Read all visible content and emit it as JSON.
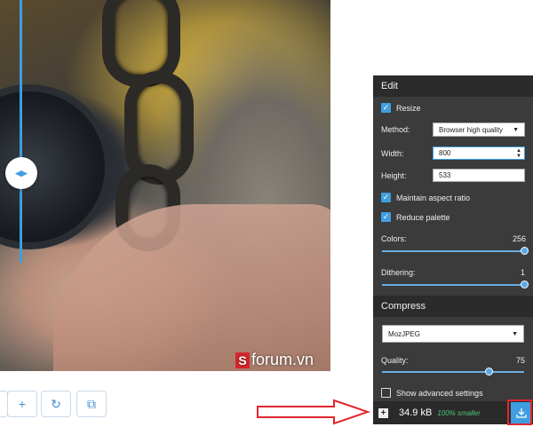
{
  "preview": {
    "watermark_letter": "S",
    "watermark_text": "forum.vn",
    "divider_handle_glyph": "◂▸"
  },
  "toolbar": {
    "zoom_in_glyph": "+",
    "rotate_glyph": "↻",
    "fit_glyph": "⧉"
  },
  "edit": {
    "header": "Edit",
    "resize_label": "Resize",
    "method_label": "Method:",
    "method_value": "Browser high quality",
    "width_label": "Width:",
    "width_value": "800",
    "height_label": "Height:",
    "height_value": "533",
    "aspect_label": "Maintain aspect ratio",
    "palette_label": "Reduce palette",
    "colors_label": "Colors:",
    "colors_value": "256",
    "colors_fraction": 1.0,
    "dithering_label": "Dithering:",
    "dithering_value": "1",
    "dithering_fraction": 1.0
  },
  "compress": {
    "header": "Compress",
    "codec_value": "MozJPEG",
    "quality_label": "Quality:",
    "quality_value": "75",
    "quality_fraction": 0.75,
    "advanced_label": "Show advanced settings"
  },
  "footer": {
    "size": "34.9 kB",
    "savings": "100% smaller"
  },
  "colors": {
    "accent": "#3e9ee0",
    "panel_bg": "#3b3b3b",
    "highlight": "#e0262e",
    "savings_green": "#4fc47a"
  }
}
